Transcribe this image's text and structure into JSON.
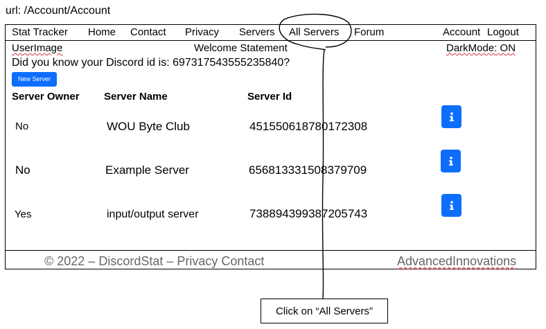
{
  "url_label": "url: /Account/Account",
  "nav": {
    "brand": "Stat Tracker",
    "items": [
      "Home",
      "Contact",
      "Privacy",
      "Servers",
      "All Servers",
      "Forum"
    ],
    "account": "Account",
    "logout": "Logout"
  },
  "subheader": {
    "user_image": "UserImage",
    "welcome": "Welcome Statement",
    "darkmode": "DarkMode: ON"
  },
  "discord_id_text": "Did you know your Discord id is: 697317543555235840?",
  "new_server_label": "New Server",
  "table": {
    "headers": [
      "Server Owner",
      "Server Name",
      "Server Id"
    ],
    "rows": [
      {
        "owner": "No",
        "name": "WOU Byte Club",
        "id": "451550618780172308"
      },
      {
        "owner": "No",
        "name": "Example Server",
        "id": "656813331508379709"
      },
      {
        "owner": "Yes",
        "name": "input/output server",
        "id": "738894399387205743"
      }
    ]
  },
  "footer": {
    "copyright": "© 2022 – DiscordStat – Privacy Contact",
    "right": "AdvancedInnovations"
  },
  "annotation": {
    "callout_text": "Click on “All Servers”"
  },
  "colors": {
    "accent": "#0d6efd",
    "footer_text": "#666666"
  },
  "icons": {
    "info": "info-icon"
  }
}
